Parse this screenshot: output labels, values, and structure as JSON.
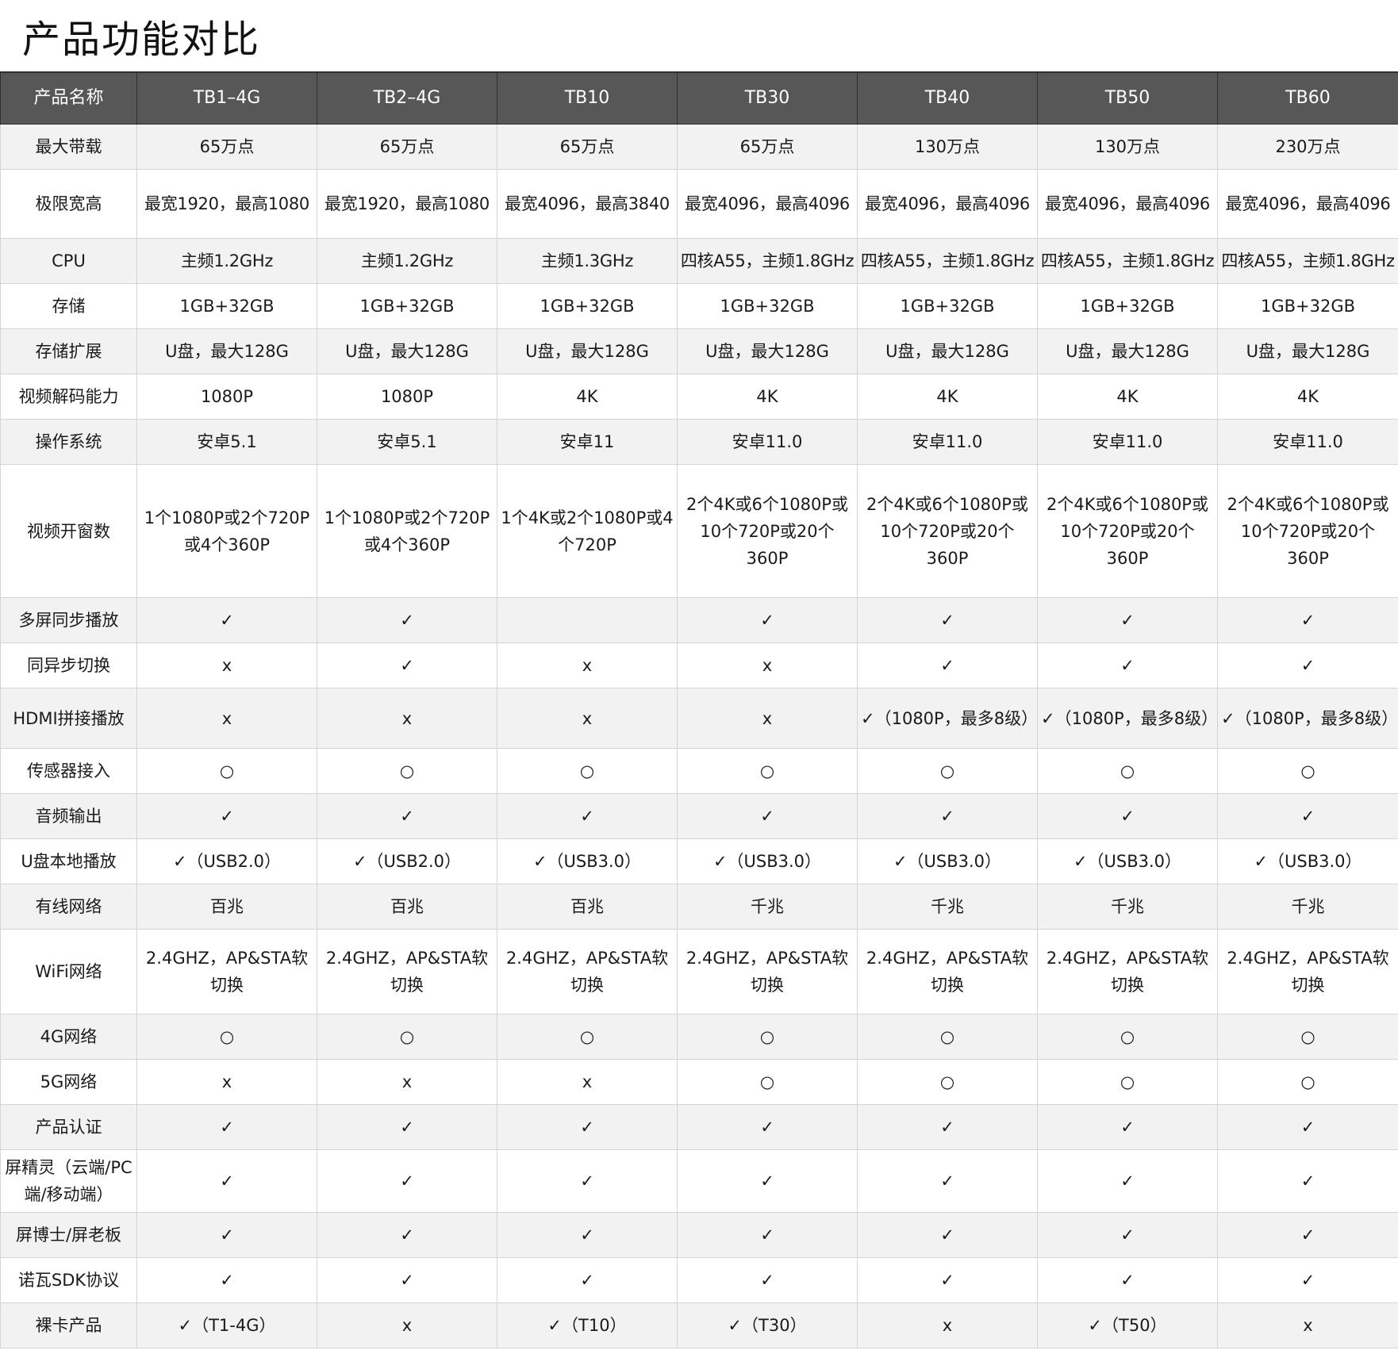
{
  "page": {
    "title": "产品功能对比"
  },
  "table": {
    "header": [
      "产品名称",
      "TB1–4G",
      "TB2–4G",
      "TB10",
      "TB30",
      "TB40",
      "TB50",
      "TB60"
    ],
    "rows": [
      {
        "label": "最大带载",
        "cells": [
          "65万点",
          "65万点",
          "65万点",
          "65万点",
          "130万点",
          "130万点",
          "230万点"
        ]
      },
      {
        "label": "极限宽高",
        "cells": [
          "最宽1920，最高1080",
          "最宽1920，最高1080",
          "最宽4096，最高3840",
          "最宽4096，最高4096",
          "最宽4096，最高4096",
          "最宽4096，最高4096",
          "最宽4096，最高4096"
        ]
      },
      {
        "label": "CPU",
        "cells": [
          "主频1.2GHz",
          "主频1.2GHz",
          "主频1.3GHz",
          "四核A55，主频1.8GHz",
          "四核A55，主频1.8GHz",
          "四核A55，主频1.8GHz",
          "四核A55，主频1.8GHz"
        ]
      },
      {
        "label": "存储",
        "cells": [
          "1GB+32GB",
          "1GB+32GB",
          "1GB+32GB",
          "1GB+32GB",
          "1GB+32GB",
          "1GB+32GB",
          "1GB+32GB"
        ]
      },
      {
        "label": "存储扩展",
        "cells": [
          "U盘，最大128G",
          "U盘，最大128G",
          "U盘，最大128G",
          "U盘，最大128G",
          "U盘，最大128G",
          "U盘，最大128G",
          "U盘，最大128G"
        ]
      },
      {
        "label": "视频解码能力",
        "cells": [
          "1080P",
          "1080P",
          "4K",
          "4K",
          "4K",
          "4K",
          "4K"
        ]
      },
      {
        "label": "操作系统",
        "cells": [
          "安卓5.1",
          "安卓5.1",
          "安卓11",
          "安卓11.0",
          "安卓11.0",
          "安卓11.0",
          "安卓11.0"
        ]
      },
      {
        "label": "视频开窗数",
        "cells": [
          "1个1080P或2个720P或4个360P",
          "1个1080P或2个720P或4个360P",
          "1个4K或2个1080P或4个720P",
          "2个4K或6个1080P或10个720P或20个360P",
          "2个4K或6个1080P或10个720P或20个360P",
          "2个4K或6个1080P或10个720P或20个360P",
          "2个4K或6个1080P或10个720P或20个360P"
        ]
      },
      {
        "label": "多屏同步播放",
        "cells": [
          "✓",
          "✓",
          "",
          "✓",
          "✓",
          "✓",
          "✓"
        ]
      },
      {
        "label": "同异步切换",
        "cells": [
          "x",
          "✓",
          "x",
          "x",
          "✓",
          "✓",
          "✓"
        ]
      },
      {
        "label": "HDMI拼接播放",
        "cells": [
          "x",
          "x",
          "x",
          "x",
          "✓（1080P，最多8级）",
          "✓（1080P，最多8级）",
          "✓（1080P，最多8级）"
        ]
      },
      {
        "label": "传感器接入",
        "cells": [
          "○",
          "○",
          "○",
          "○",
          "○",
          "○",
          "○"
        ]
      },
      {
        "label": "音频输出",
        "cells": [
          "✓",
          "✓",
          "✓",
          "✓",
          "✓",
          "✓",
          "✓"
        ]
      },
      {
        "label": "U盘本地播放",
        "cells": [
          "✓（USB2.0）",
          "✓（USB2.0）",
          "✓（USB3.0）",
          "✓（USB3.0）",
          "✓（USB3.0）",
          "✓（USB3.0）",
          "✓（USB3.0）"
        ]
      },
      {
        "label": "有线网络",
        "cells": [
          "百兆",
          "百兆",
          "百兆",
          "千兆",
          "千兆",
          "千兆",
          "千兆"
        ]
      },
      {
        "label": "WiFi网络",
        "cells": [
          "2.4GHZ，AP&STA软切换",
          "2.4GHZ，AP&STA软切换",
          "2.4GHZ，AP&STA软切换",
          "2.4GHZ，AP&STA软切换",
          "2.4GHZ，AP&STA软切换",
          "2.4GHZ，AP&STA软切换",
          "2.4GHZ，AP&STA软切换"
        ]
      },
      {
        "label": "4G网络",
        "cells": [
          "○",
          "○",
          "○",
          "○",
          "○",
          "○",
          "○"
        ]
      },
      {
        "label": "5G网络",
        "cells": [
          "x",
          "x",
          "x",
          "○",
          "○",
          "○",
          "○"
        ]
      },
      {
        "label": "产品认证",
        "cells": [
          "✓",
          "✓",
          "✓",
          "✓",
          "✓",
          "✓",
          "✓"
        ]
      },
      {
        "label": "屏精灵（云端/PC端/移动端）",
        "cells": [
          "✓",
          "✓",
          "✓",
          "✓",
          "✓",
          "✓",
          "✓"
        ]
      },
      {
        "label": "屏博士/屏老板",
        "cells": [
          "✓",
          "✓",
          "✓",
          "✓",
          "✓",
          "✓",
          "✓"
        ]
      },
      {
        "label": "诺瓦SDK协议",
        "cells": [
          "✓",
          "✓",
          "✓",
          "✓",
          "✓",
          "✓",
          "✓"
        ]
      },
      {
        "label": "裸卡产品",
        "cells": [
          "✓（T1-4G）",
          "x",
          "✓（T10）",
          "✓（T30）",
          "x",
          "✓（T50）",
          "x"
        ]
      }
    ]
  }
}
